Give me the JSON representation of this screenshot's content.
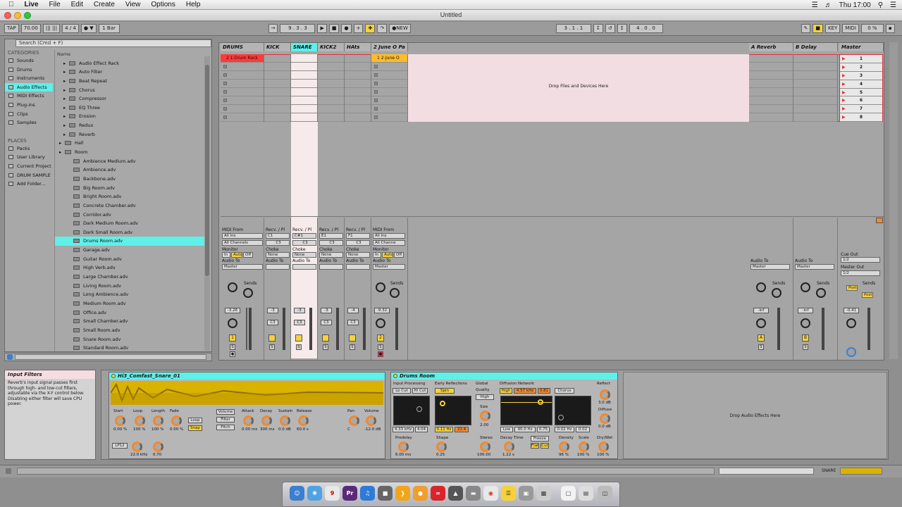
{
  "menubar": {
    "app": "Live",
    "items": [
      "File",
      "Edit",
      "Create",
      "View",
      "Options",
      "Help"
    ],
    "time": "Thu 17:00"
  },
  "window": {
    "title": "Untitled"
  },
  "control": {
    "tap": "TAP",
    "tempo": "70.00",
    "sig": "4 / 4",
    "quant": "1 Bar",
    "pos": "9 .  3 .  3",
    "new": "NEW",
    "loop_start": "3 .  1 .  1",
    "loop_len": "4 .  0 .  0",
    "key": "KEY",
    "midi": "MIDI",
    "cpu": "0 %"
  },
  "browser": {
    "search_placeholder": "Search (Cmd + F)",
    "categories_head": "CATEGORIES",
    "categories": [
      "Sounds",
      "Drums",
      "Instruments",
      "Audio Effects",
      "MIDI Effects",
      "Plug-ins",
      "Clips",
      "Samples"
    ],
    "places_head": "PLACES",
    "places": [
      "Packs",
      "User Library",
      "Current Project",
      "DRUM SAMPLE",
      "Add Folder..."
    ],
    "name_head": "Name",
    "items": [
      {
        "l": "Audio Effect Rack",
        "d": 0
      },
      {
        "l": "Auto Filter",
        "d": 0
      },
      {
        "l": "Beat Repeat",
        "d": 0
      },
      {
        "l": "Chorus",
        "d": 0
      },
      {
        "l": "Compressor",
        "d": 0
      },
      {
        "l": "EQ Three",
        "d": 0
      },
      {
        "l": "Erosion",
        "d": 0
      },
      {
        "l": "Redux",
        "d": 0
      },
      {
        "l": "Reverb",
        "d": 0
      },
      {
        "l": "Hall",
        "d": 1
      },
      {
        "l": "Room",
        "d": 1
      },
      {
        "l": "Ambience Medium.adv",
        "d": 2
      },
      {
        "l": "Ambience.adv",
        "d": 2
      },
      {
        "l": "Backbone.adv",
        "d": 2
      },
      {
        "l": "Big Room.adv",
        "d": 2
      },
      {
        "l": "Bright Room.adv",
        "d": 2
      },
      {
        "l": "Concrete Chamber.adv",
        "d": 2
      },
      {
        "l": "Corridor.adv",
        "d": 2
      },
      {
        "l": "Dark Medium Room.adv",
        "d": 2
      },
      {
        "l": "Dark Small Room.adv",
        "d": 2
      },
      {
        "l": "Drums Room.adv",
        "d": 2
      },
      {
        "l": "Garage.adv",
        "d": 2
      },
      {
        "l": "Guitar Room.adv",
        "d": 2
      },
      {
        "l": "High Verb.adv",
        "d": 2
      },
      {
        "l": "Large Chamber.adv",
        "d": 2
      },
      {
        "l": "Living Room.adv",
        "d": 2
      },
      {
        "l": "Long Ambience.adv",
        "d": 2
      },
      {
        "l": "Medium Room.adv",
        "d": 2
      },
      {
        "l": "Office.adv",
        "d": 2
      },
      {
        "l": "Small Chamber.adv",
        "d": 2
      },
      {
        "l": "Small Room.adv",
        "d": 2
      },
      {
        "l": "Snare Room.adv",
        "d": 2
      },
      {
        "l": "Standard Room.adv",
        "d": 2
      }
    ],
    "selected": "Drums Room.adv"
  },
  "tracks": [
    {
      "name": "DRUMS",
      "clip": "2 1-Drum Rack",
      "vol": "-3.26",
      "num": "1",
      "routing_from": "MIDI From",
      "from1": "All Ins",
      "from2": "All Channels"
    },
    {
      "name": "KICK",
      "vol": "-3",
      "num": "",
      "recv": "Recv. / Pl",
      "note": "C1",
      "note2": "C3"
    },
    {
      "name": "SNARE",
      "vol": "-3",
      "num": "",
      "recv": "Recv. / Pl",
      "note": "C#1",
      "note2": "C3"
    },
    {
      "name": "KICK2",
      "vol": "-3",
      "num": "",
      "recv": "Recv. / Pl",
      "note": "E1",
      "note2": "C3"
    },
    {
      "name": "HAts",
      "vol": "-4",
      "num": "",
      "recv": "Recv. / Pl",
      "note": "F1",
      "note2": "C3"
    },
    {
      "name": "2 June O Pa",
      "clip": "1 2-June O",
      "vol": "-9.32",
      "num": "2",
      "routing_from": "MIDI From",
      "from1": "All Ins",
      "from2": "All Channe"
    }
  ],
  "returns": [
    {
      "name": "A Reverb",
      "vol": "-inf",
      "btn": "A"
    },
    {
      "name": "B Delay",
      "vol": "-inf",
      "btn": "B"
    }
  ],
  "master": {
    "name": "Master",
    "scenes": [
      "1",
      "2",
      "3",
      "4",
      "5",
      "6",
      "7",
      "8"
    ],
    "vol": "-0.41",
    "cue": "Cue Out",
    "cue_v": "1/2",
    "mout": "Master Out",
    "mout_v": "1/2"
  },
  "session_labels": {
    "drop": "Drop Files and Devices Here",
    "monitor": "Monitor",
    "in": "In",
    "auto": "Auto",
    "off": "Off",
    "audio_to": "Audio To",
    "master": "Master",
    "sends": "Sends",
    "choke": "Choke",
    "none": "None",
    "post": "Post"
  },
  "info": {
    "title": "Input Filters",
    "body": "Reverb's input signal passes first through high- and low-cut filters, adjustable via the X-Y control below. Disabling either filter will save CPU power."
  },
  "sampler": {
    "name": "Hi3_Comfast_Snare_01",
    "labels": [
      "Start",
      "Loop",
      "Length",
      "Fade",
      "Attack",
      "Decay",
      "Sustain",
      "Release",
      "Pan",
      "Volume"
    ],
    "values": [
      "0.00 %",
      "100 %",
      "100 %",
      "0.00 %",
      "0.00 ms",
      "300 ms",
      "0.0 dB",
      "60.0 s",
      "C",
      "-12.0 dB"
    ],
    "filter": "Filter",
    "pitch": "Pitch",
    "volume_tab": "Volume",
    "loop": "Loop",
    "snap": "Snap",
    "freq": "22.0 kHz",
    "res": "0.70",
    "type": "LP12"
  },
  "reverb": {
    "name": "Drums Room",
    "sections": [
      "Input Processing",
      "Early Reflections",
      "Global",
      "Diffusion Network",
      "Reflect"
    ],
    "locut": "Lo Cut",
    "hicut": "Hi Cut",
    "spin": "Spin",
    "quality": "Quality",
    "quality_v": "High",
    "size": "Size",
    "size_v": "2.00",
    "hi": "High",
    "hi_freq": "4.57 kHz",
    "hi_v": "0.81",
    "chorus": "Chorus",
    "reflect_v": "3.0 dB",
    "diffuse": "Diffuse",
    "diffuse_v": "0.0 dB",
    "in_freq": "4.33 kHz",
    "in_q": "4.04",
    "er_freq": "0.11 Hz",
    "er_amt": "22.4",
    "low": "Low",
    "low_freq": "90.0 Hz",
    "low_v": "0.75",
    "low_v2": "0.02 Hz",
    "low_v3": "0.02",
    "predelay": "Predelay",
    "predelay_v": "6.00 ms",
    "shape": "Shape",
    "shape_v": "0.25",
    "stereo": "Stereo",
    "stereo_v": "100.00",
    "decay": "Decay Time",
    "decay_v": "1.22 s",
    "freeze": "Freeze",
    "flat": "Flat",
    "cut": "Cut",
    "density": "Density",
    "density_v": "96 %",
    "scale": "Scale",
    "scale_v": "100 %",
    "drywet": "Dry/Wet",
    "drywet_v": "100 %"
  },
  "detail_drop": "Drop Audio Effects Here",
  "statusbar": {
    "track": "SNARE"
  }
}
